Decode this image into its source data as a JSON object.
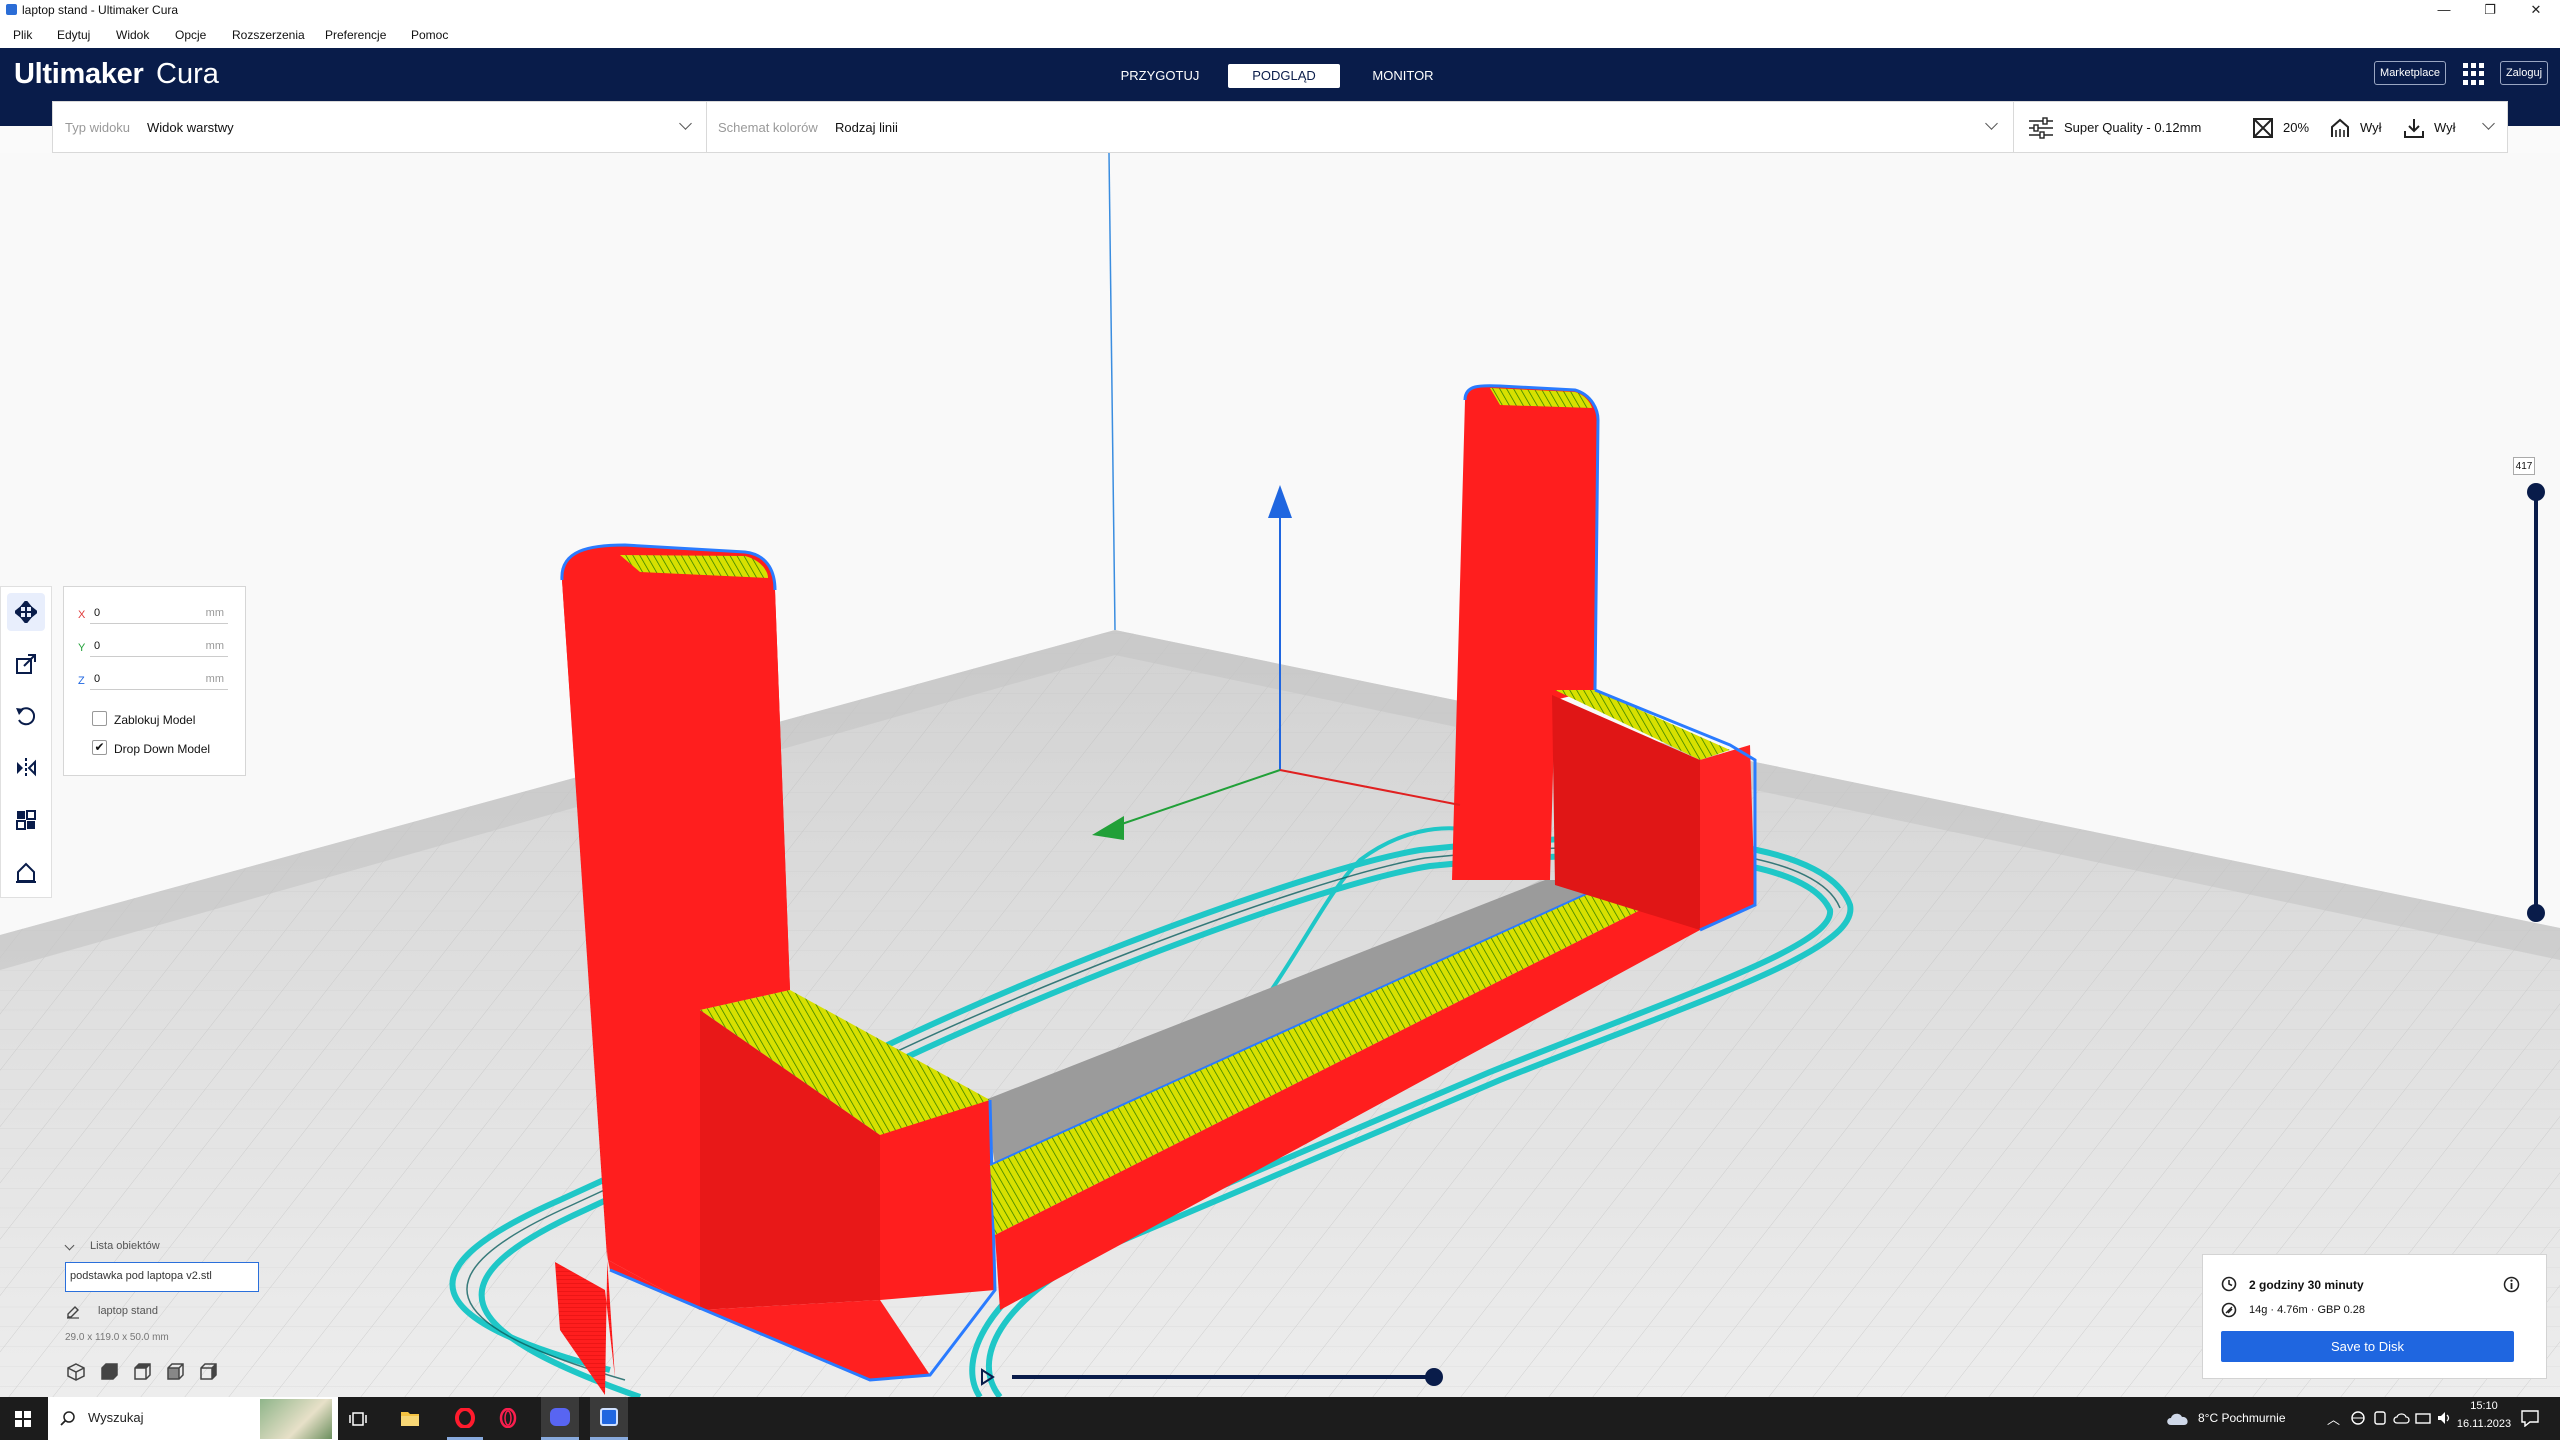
{
  "window": {
    "title": "laptop stand - Ultimaker Cura"
  },
  "menu": [
    "Plik",
    "Edytuj",
    "Widok",
    "Opcje",
    "Rozszerzenia",
    "Preferencje",
    "Pomoc"
  ],
  "header": {
    "logo_strong": "Ultimaker",
    "logo_light": "Cura",
    "stages": [
      "PRZYGOTUJ",
      "PODGLĄD",
      "MONITOR"
    ],
    "active_stage": "PODGLĄD",
    "marketplace": "Marketplace",
    "login": "Zaloguj"
  },
  "viewbar": {
    "view_type_label": "Typ widoku",
    "view_type_value": "Widok warstwy",
    "color_scheme_label": "Schemat kolorów",
    "color_scheme_value": "Rodzaj linii",
    "profile": "Super Quality - 0.12mm",
    "infill": "20%",
    "support": "Wył",
    "adhesion": "Wył"
  },
  "move_panel": {
    "x_label": "X",
    "y_label": "Y",
    "z_label": "Z",
    "x": "0",
    "y": "0",
    "z": "0",
    "unit": "mm",
    "lock_model": "Zablokuj Model",
    "drop_down_model": "Drop Down Model",
    "lock_checked": false,
    "drop_checked": true
  },
  "object_list": {
    "header": "Lista obiektów",
    "file": "podstawka pod laptopa v2.stl",
    "name": "laptop stand",
    "dimensions": "29.0 x 119.0 x 50.0 mm"
  },
  "print_info": {
    "time": "2 godziny 30 minuty",
    "material": "14g · 4.76m · GBP 0.28",
    "save_button": "Save to Disk"
  },
  "layer_slider": {
    "max_layer": "417",
    "current_fraction": 1.0
  },
  "simulation": {
    "progress_fraction": 1.0
  },
  "taskbar": {
    "search_placeholder": "Wyszukaj",
    "weather": "8°C  Pochmurnie",
    "time": "15:10",
    "date": "16.11.2023"
  },
  "colors": {
    "header_bg": "#091c4a",
    "accent_blue": "#1f66e0",
    "wall_red": "#ff1e1e",
    "infill_yellow": "#d8e000",
    "skirt_cyan": "#1fc7c7"
  }
}
